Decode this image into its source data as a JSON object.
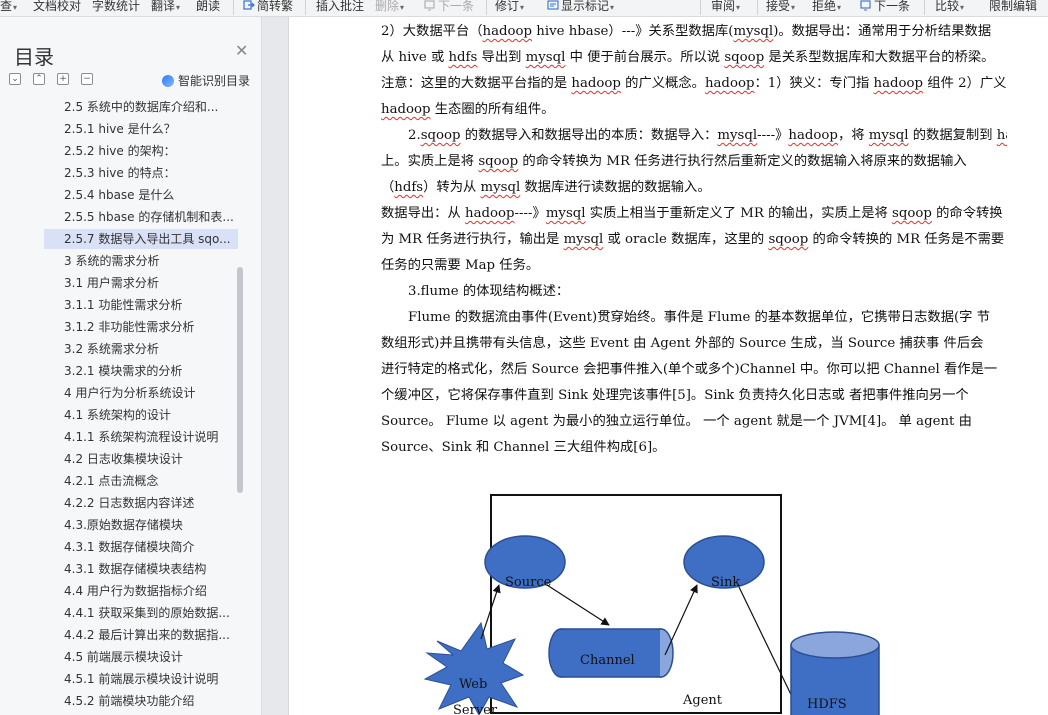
{
  "toolbar": {
    "items": [
      {
        "label": "查",
        "caret": true
      },
      {
        "label": "文档校对"
      },
      {
        "label": "字数统计"
      },
      {
        "label": "翻译",
        "caret": true
      },
      {
        "label": "朗读"
      },
      {
        "label": "简转繁",
        "icon": "convert-icon"
      },
      {
        "label": "插入批注"
      },
      {
        "label": "删除",
        "caret": true,
        "disabled": true
      },
      {
        "label": "下一条",
        "disabled": true,
        "icon": "next-comment-icon"
      },
      {
        "label": "修订",
        "caret": true
      },
      {
        "label": "显示标记",
        "caret": true,
        "icon": "show-markup-icon"
      },
      {
        "label": "审阅",
        "caret": true
      },
      {
        "label": "接受",
        "caret": true
      },
      {
        "label": "拒绝",
        "caret": true
      },
      {
        "label": "下一条",
        "icon": "next-change-icon"
      },
      {
        "label": "比较",
        "caret": true
      },
      {
        "label": "限制编辑"
      }
    ]
  },
  "sidebar": {
    "title": "目录",
    "smart_label": "智能识别目录",
    "toc": [
      "2.5  系统中的数据库介绍和...",
      "2.5.1 hive 是什么？",
      "2.5.2 hive 的架构：",
      "2.5.3 hive 的特点：",
      "2.5.4 hbase 是什么",
      "2.5.5 hbase 的存储机制和表...",
      "2.5.7  数据导入导出工具 sqo...",
      "3  系统的需求分析",
      "3.1  用户需求分析",
      "3.1.1  功能性需求分析",
      "3.1.2  非功能性需求分析",
      "3.2  系统需求分析",
      "3.2.1  模块需求的分析",
      "4 用户行为分析系统设计",
      "4.1  系统架构的设计",
      "4.1.1  系统架构流程设计说明",
      "4.2  日志收集模块设计",
      "4.2.1  点击流概念",
      "4.2.2  日志数据内容详述",
      "4.3.原始数据存储模块",
      "4.3.1 数据存储模块简介",
      "4.3.1  数据存储模块表结构",
      "4.4  用户行为数据指标介绍",
      "4.4.1  获取采集到的原始数据...",
      "4.4.2  最后计算出来的数据指...",
      "4.5  前端展示模块设计",
      "4.5.1  前端展示模块设计说明",
      "4.5.2  前端模块功能介绍"
    ],
    "selected_index": 6
  },
  "document": {
    "lines": [
      {
        "text": "2）大数据平台（hadoop   hive   hbase）---》关系型数据库(mysql)。数据导出：通常用于分析结果数据",
        "indent": false
      },
      {
        "text": "从 hive 或 hdfs 导出到 mysql 中    便于前台展示。所以说 sqoop 是关系型数据库和大数据平台的桥梁。",
        "indent": false
      },
      {
        "text": "注意：这里的大数据平台指的是 hadoop 的广义概念。hadoop：1）狭义：专门指 hadoop 组件 2）广义：",
        "indent": false
      },
      {
        "text": "hadoop 生态圈的所有组件。",
        "indent": false
      },
      {
        "text": "2.sqoop 的数据导入和数据导出的本质：数据导入：mysql----》hadoop，将 mysql 的数据复制到 hadoop",
        "indent": true
      },
      {
        "text": "上。实质上是将 sqoop 的命令转换为 MR 任务进行执行然后重新定义的数据输入将原来的数据输入",
        "indent": false
      },
      {
        "text": "（hdfs）转为从 mysql 数据库进行读数据的数据输入。",
        "indent": false
      },
      {
        "text": "数据导出：从 hadoop----》mysql 实质上相当于重新定义了 MR 的输出，实质上是将 sqoop 的命令转换",
        "indent": false
      },
      {
        "text": "为 MR 任务进行执行，输出是 mysql 或 oracle 数据库，这里的 sqoop 的命令转换的 MR 任务是不需要 reduce",
        "indent": false
      },
      {
        "text": "任务的只需要 Map 任务。",
        "indent": false
      },
      {
        "text": "3.flume 的体现结构概述：",
        "indent": true
      },
      {
        "text": "Flume 的数据流由事件(Event)贯穿始终。事件是 Flume 的基本数据单位，它携带日志数据(字 节",
        "indent": true
      },
      {
        "text": "数组形式)并且携带有头信息，这些 Event 由 Agent 外部的 Source 生成，当 Source 捕获事 件后会",
        "indent": false
      },
      {
        "text": "进行特定的格式化，然后 Source 会把事件推入(单个或多个)Channel 中。你可以把 Channel 看作是一",
        "indent": false
      },
      {
        "text": "个缓冲区，它将保存事件直到 Sink 处理完该事件[5]。Sink 负责持久化日志或 者把事件推向另一个",
        "indent": false
      },
      {
        "text": "Source。 Flume 以 agent 为最小的独立运行单位。 一个 agent 就是一个 JVM[4]。 单 agent 由",
        "indent": false
      },
      {
        "text": "Source、Sink 和 Channel 三大组件构成[6]。",
        "indent": false
      }
    ],
    "diagram": {
      "source": "Source",
      "sink": "Sink",
      "channel": "Channel",
      "agent": "Agent",
      "hdfs": "HDFS",
      "web_line1": "Web",
      "web_line2": "Server"
    }
  },
  "colors": {
    "node_fill": "#3f6fc4",
    "node_stroke": "#2c4f93",
    "selected_bg": "#d8e1f5",
    "spell_underline": "#dd3333"
  }
}
